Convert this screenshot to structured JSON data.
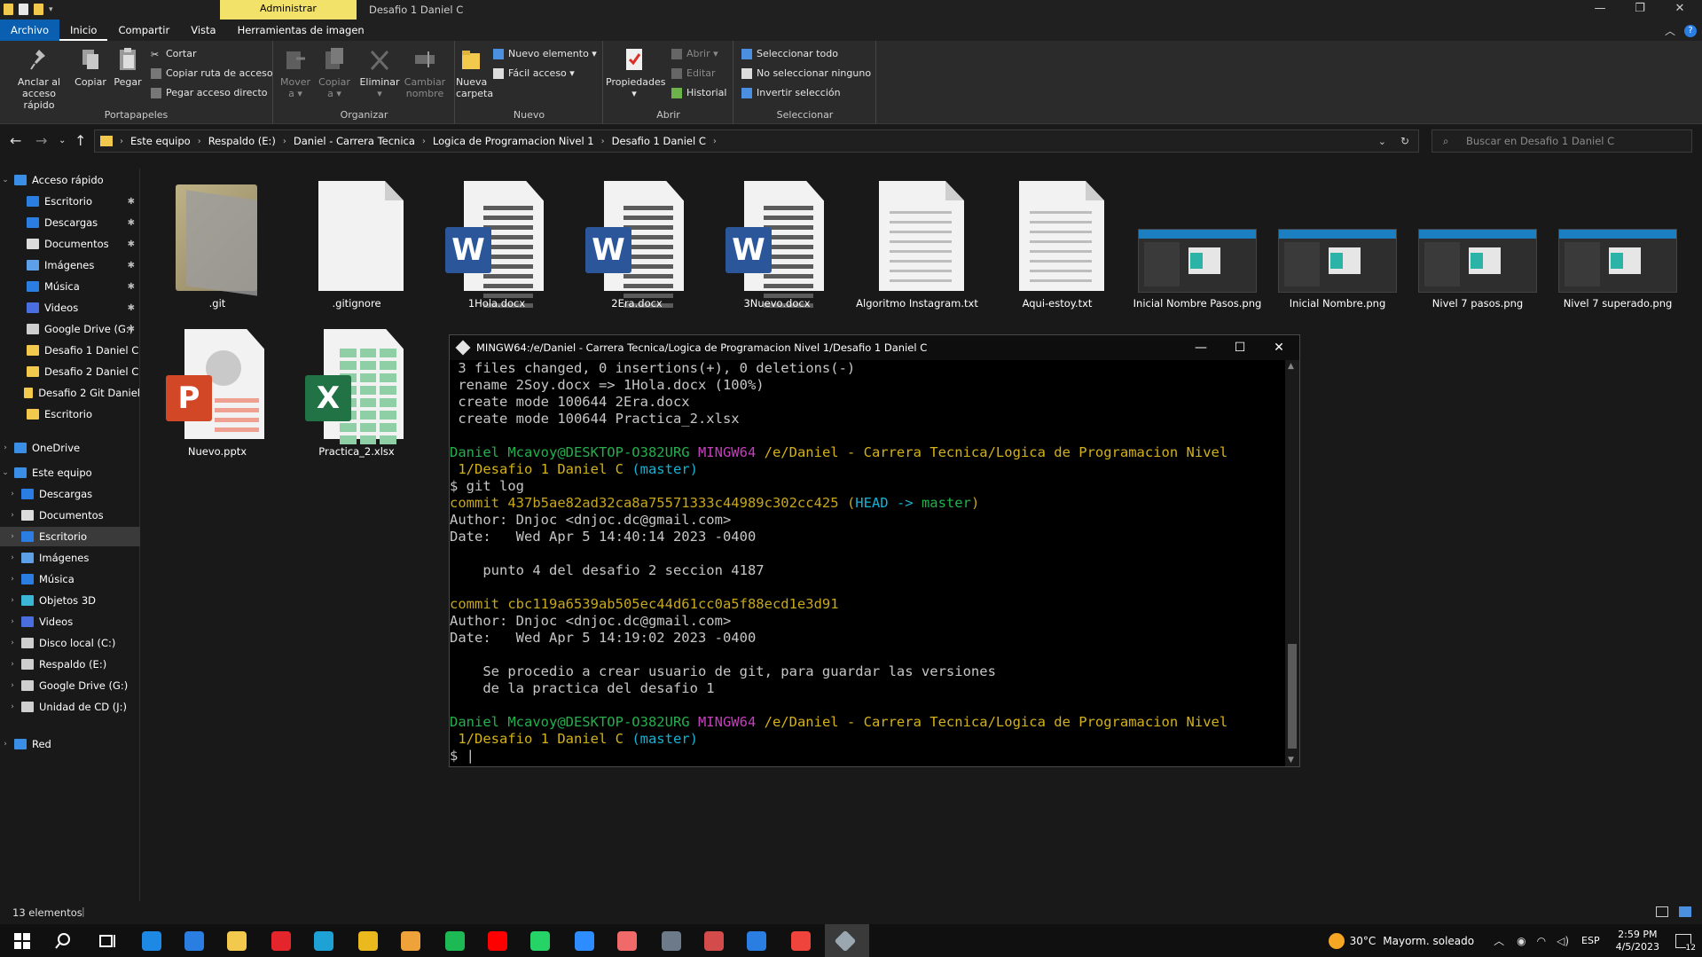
{
  "titlebar": {
    "context_tab": "Administrar",
    "title": "Desafio 1 Daniel C",
    "minimize": "—",
    "maximize": "❐",
    "close": "✕"
  },
  "ribbon_tabs": [
    "Archivo",
    "Inicio",
    "Compartir",
    "Vista",
    "Herramientas de imagen"
  ],
  "ribbon": {
    "groups": {
      "portapapeles": "Portapapeles",
      "organizar": "Organizar",
      "nuevo": "Nuevo",
      "abrir": "Abrir",
      "seleccionar": "Seleccionar"
    },
    "anclar": [
      "Anclar al",
      "acceso rápido"
    ],
    "copiar": "Copiar",
    "pegar": "Pegar",
    "cortar": "Cortar",
    "copiar_ruta": "Copiar ruta de acceso",
    "pegar_acceso": "Pegar acceso directo",
    "mover": [
      "Mover",
      "a ▾"
    ],
    "copiar_a": [
      "Copiar",
      "a ▾"
    ],
    "eliminar": [
      "Eliminar",
      "▾"
    ],
    "cambiar_nombre": [
      "Cambiar",
      "nombre"
    ],
    "nueva_carpeta": [
      "Nueva",
      "carpeta"
    ],
    "nuevo_elemento": "Nuevo elemento ▾",
    "facil_acceso": "Fácil acceso ▾",
    "propiedades": [
      "Propiedades",
      "▾"
    ],
    "abrir_btn": "Abrir ▾",
    "editar": "Editar",
    "historial": "Historial",
    "seleccionar_todo": "Seleccionar todo",
    "no_seleccionar": "No seleccionar ninguno",
    "invertir": "Invertir selección"
  },
  "address": {
    "crumbs": [
      "Este equipo",
      "Respaldo (E:)",
      "Daniel - Carrera Tecnica",
      "Logica de Programacion Nivel 1",
      "Desafio 1 Daniel C"
    ],
    "search_placeholder": "Buscar en Desafio 1 Daniel C"
  },
  "nav": {
    "quick_access": "Acceso rápido",
    "quick_items": [
      "Escritorio",
      "Descargas",
      "Documentos",
      "Imágenes",
      "Música",
      "Videos",
      "Google Drive (G:)",
      "Desafio 1 Daniel C",
      "Desafio 2 Daniel C",
      "Desafio 2 Git Daniel",
      "Escritorio"
    ],
    "onedrive": "OneDrive",
    "this_pc": "Este equipo",
    "pc_items": [
      "Descargas",
      "Documentos",
      "Escritorio",
      "Imágenes",
      "Música",
      "Objetos 3D",
      "Videos",
      "Disco local (C:)",
      "Respaldo (E:)",
      "Google Drive (G:)",
      "Unidad de CD (J:)"
    ],
    "network": "Red"
  },
  "files": [
    {
      "name": ".git",
      "type": "folder"
    },
    {
      "name": ".gitignore",
      "type": "blank"
    },
    {
      "name": "1Hola.docx",
      "type": "word"
    },
    {
      "name": "2Era.docx",
      "type": "word"
    },
    {
      "name": "3Nuevo.docx",
      "type": "word"
    },
    {
      "name": "Algoritmo Instagram.txt",
      "type": "text"
    },
    {
      "name": "Aqui-estoy.txt",
      "type": "text"
    },
    {
      "name": "Inicial Nombre Pasos.png",
      "type": "image"
    },
    {
      "name": "Inicial Nombre.png",
      "type": "image"
    },
    {
      "name": "Nivel 7 pasos.png",
      "type": "image"
    },
    {
      "name": "Nivel 7 superado.png",
      "type": "image"
    },
    {
      "name": "Nuevo.pptx",
      "type": "powerpoint"
    },
    {
      "name": "Practica_2.xlsx",
      "type": "excel"
    }
  ],
  "word_letter": "W",
  "ppt_letter": "P",
  "xls_letter": "X",
  "status": {
    "count": "13 elementos"
  },
  "terminal": {
    "title": "MINGW64:/e/Daniel - Carrera Tecnica/Logica de Programacion Nivel 1/Desafio 1 Daniel C",
    "lines": [
      [
        {
          "t": " 3 files changed, 0 insertions(+), 0 deletions(-)",
          "c": ""
        }
      ],
      [
        {
          "t": " rename 2Soy.docx => 1Hola.docx (100%)",
          "c": ""
        }
      ],
      [
        {
          "t": " create mode 100644 2Era.docx",
          "c": ""
        }
      ],
      [
        {
          "t": " create mode 100644 Practica_2.xlsx",
          "c": ""
        }
      ],
      [
        {
          "t": "",
          "c": ""
        }
      ],
      [
        {
          "t": "Daniel Mcavoy@DESKTOP-O382URG ",
          "c": "g"
        },
        {
          "t": "MINGW64 ",
          "c": "m"
        },
        {
          "t": "/e/Daniel - Carrera Tecnica/Logica de Programacion Nivel",
          "c": "y"
        }
      ],
      [
        {
          "t": " 1/Desafio 1 Daniel C ",
          "c": "y"
        },
        {
          "t": "(master)",
          "c": "c"
        }
      ],
      [
        {
          "t": "$ git log",
          "c": ""
        }
      ],
      [
        {
          "t": "commit 437b5ae82ad32ca8a75571333c44989c302cc425 ",
          "c": "cy"
        },
        {
          "t": "(",
          "c": "cy"
        },
        {
          "t": "HEAD -> ",
          "c": "c"
        },
        {
          "t": "master",
          "c": "g"
        },
        {
          "t": ")",
          "c": "cy"
        }
      ],
      [
        {
          "t": "Author: Dnjoc <dnjoc.dc@gmail.com>",
          "c": ""
        }
      ],
      [
        {
          "t": "Date:   Wed Apr 5 14:40:14 2023 -0400",
          "c": ""
        }
      ],
      [
        {
          "t": "",
          "c": ""
        }
      ],
      [
        {
          "t": "    punto 4 del desafio 2 seccion 4187",
          "c": ""
        }
      ],
      [
        {
          "t": "",
          "c": ""
        }
      ],
      [
        {
          "t": "commit cbc119a6539ab505ec44d61cc0a5f88ecd1e3d91",
          "c": "cy"
        }
      ],
      [
        {
          "t": "Author: Dnjoc <dnjoc.dc@gmail.com>",
          "c": ""
        }
      ],
      [
        {
          "t": "Date:   Wed Apr 5 14:19:02 2023 -0400",
          "c": ""
        }
      ],
      [
        {
          "t": "",
          "c": ""
        }
      ],
      [
        {
          "t": "    Se procedio a crear usuario de git, para guardar las versiones",
          "c": ""
        }
      ],
      [
        {
          "t": "    de la practica del desafio 1",
          "c": ""
        }
      ],
      [
        {
          "t": "",
          "c": ""
        }
      ],
      [
        {
          "t": "Daniel Mcavoy@DESKTOP-O382URG ",
          "c": "g"
        },
        {
          "t": "MINGW64 ",
          "c": "m"
        },
        {
          "t": "/e/Daniel - Carrera Tecnica/Logica de Programacion Nivel",
          "c": "y"
        }
      ],
      [
        {
          "t": " 1/Desafio 1 Daniel C ",
          "c": "y"
        },
        {
          "t": "(master)",
          "c": "c"
        }
      ],
      [
        {
          "t": "$ |",
          "c": ""
        }
      ]
    ]
  },
  "taskbar": {
    "weather_temp": "30°C",
    "weather_text": "Mayorm. soleado",
    "lang": "ESP",
    "time": "2:59 PM",
    "date": "4/5/2023",
    "notif_count": "12"
  }
}
